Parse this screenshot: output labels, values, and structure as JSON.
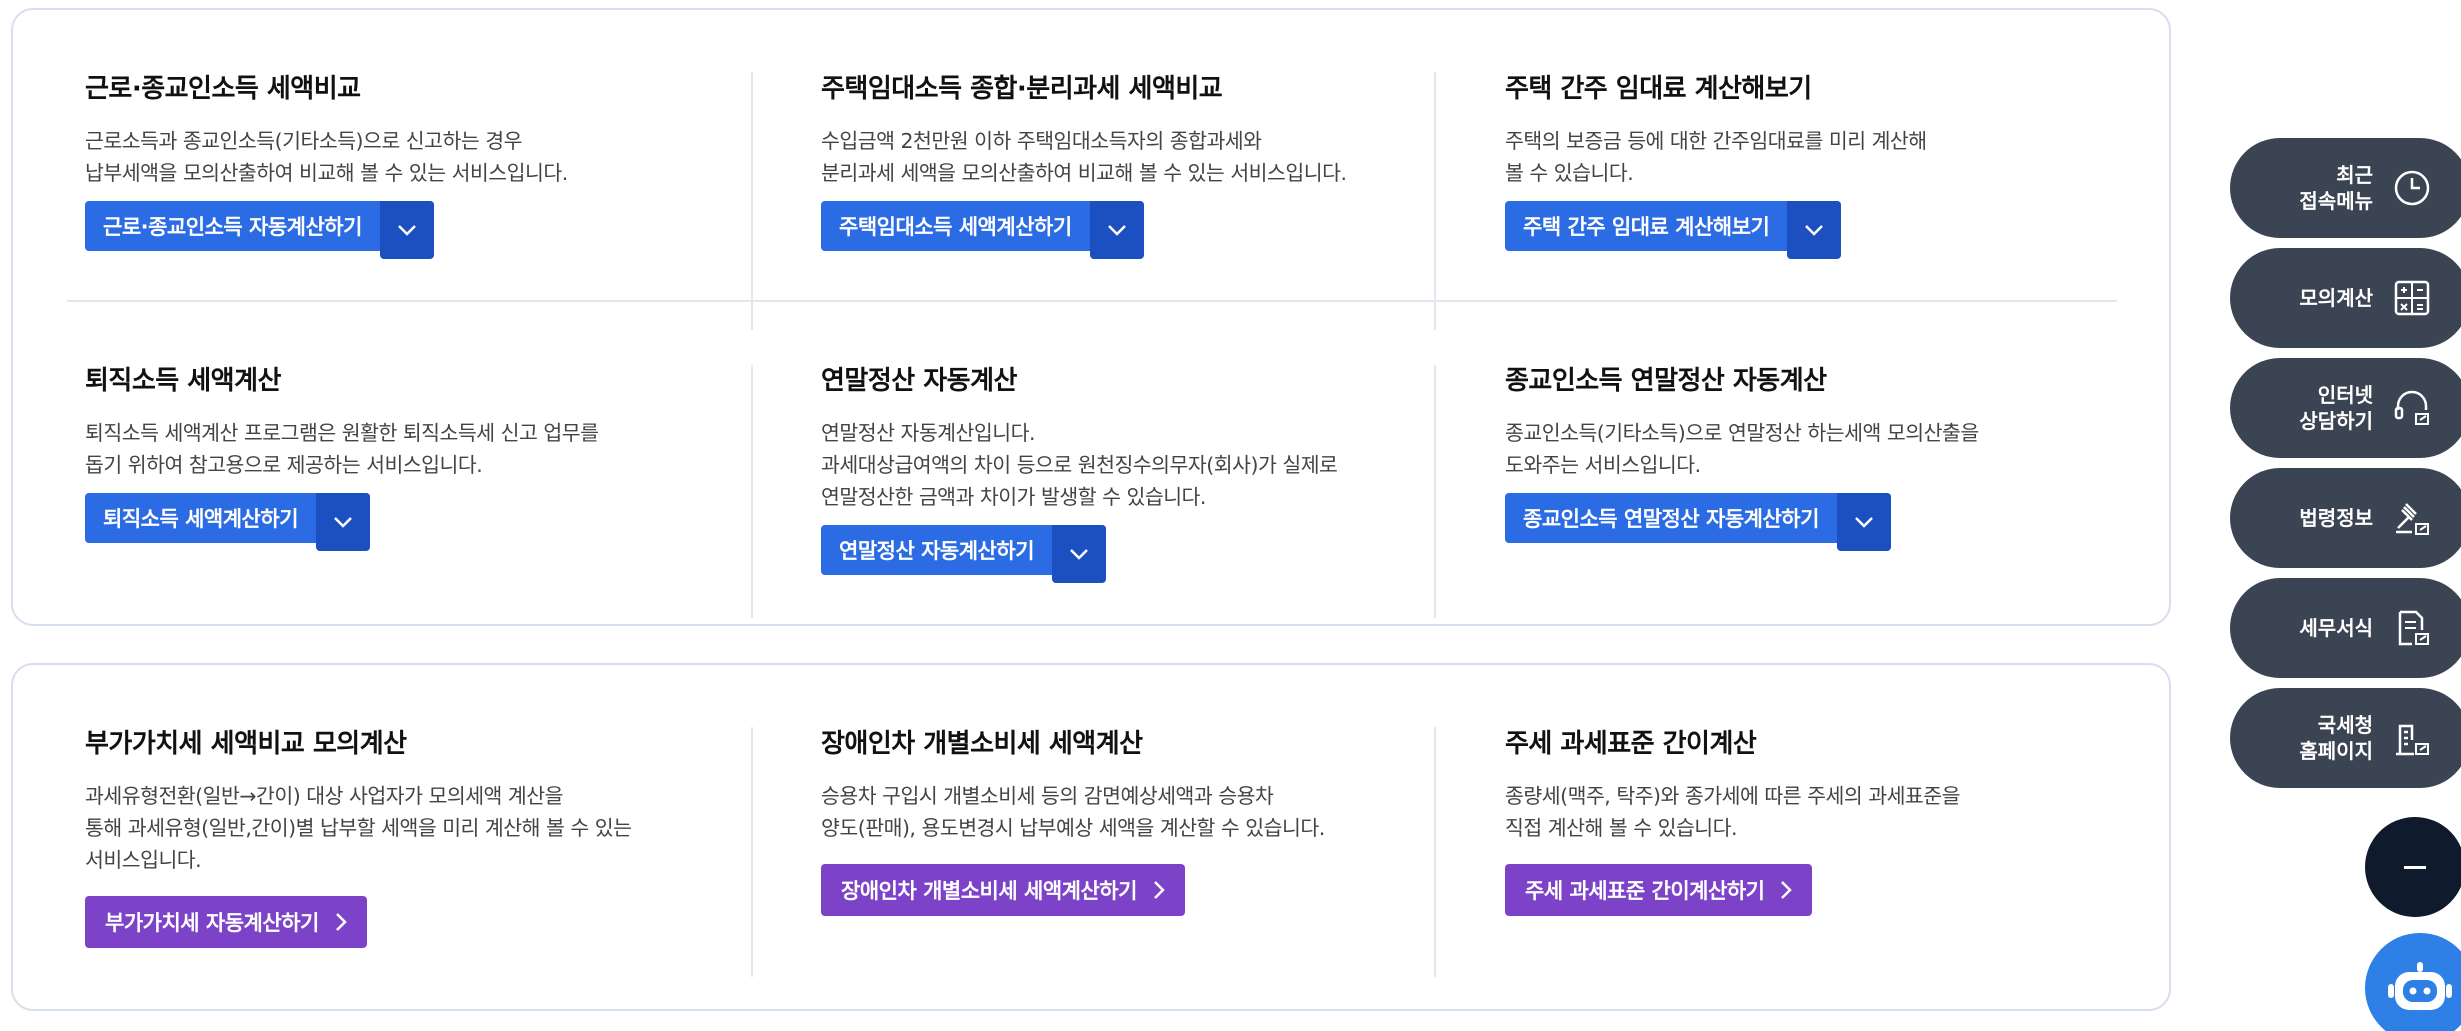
{
  "section1": {
    "cards": [
      {
        "title": "근로·종교인소득 세액비교",
        "desc": "근로소득과 종교인소득(기타소득)으로 신고하는 경우\n납부세액을 모의산출하여 비교해 볼 수 있는 서비스입니다.",
        "button": "근로·종교인소득 자동계산하기"
      },
      {
        "title": "주택임대소득 종합·분리과세 세액비교",
        "desc": "수입금액 2천만원 이하 주택임대소득자의 종합과세와\n분리과세 세액을 모의산출하여 비교해 볼 수 있는 서비스입니다.",
        "button": "주택임대소득 세액계산하기"
      },
      {
        "title": "주택 간주 임대료 계산해보기",
        "desc": "주택의 보증금 등에 대한 간주임대료를 미리 계산해\n볼 수 있습니다.",
        "button": "주택 간주 임대료 계산해보기"
      },
      {
        "title": "퇴직소득 세액계산",
        "desc": "퇴직소득 세액계산 프로그램은 원활한 퇴직소득세 신고 업무를\n돕기 위하여 참고용으로 제공하는 서비스입니다.",
        "button": "퇴직소득 세액계산하기"
      },
      {
        "title": "연말정산 자동계산",
        "desc": "연말정산 자동계산입니다.\n과세대상급여액의 차이 등으로 원천징수의무자(회사)가 실제로\n연말정산한 금액과 차이가 발생할 수 있습니다.",
        "button": "연말정산 자동계산하기"
      },
      {
        "title": "종교인소득 연말정산 자동계산",
        "desc": "종교인소득(기타소득)으로 연말정산 하는세액 모의산출을\n도와주는 서비스입니다.",
        "button": "종교인소득 연말정산 자동계산하기"
      }
    ]
  },
  "section2": {
    "cards": [
      {
        "title": "부가가치세 세액비교 모의계산",
        "desc": "과세유형전환(일반→간이) 대상 사업자가 모의세액 계산을\n통해 과세유형(일반,간이)별 납부할 세액을 미리 계산해 볼 수 있는\n서비스입니다.",
        "button": "부가가치세 자동계산하기"
      },
      {
        "title": "장애인차 개별소비세 세액계산",
        "desc": "승용차 구입시 개별소비세 등의 감면예상세액과 승용차\n양도(판매), 용도변경시 납부예상 세액을 계산할 수 있습니다.",
        "button": "장애인차 개별소비세 세액계산하기"
      },
      {
        "title": "주세 과세표준 간이계산",
        "desc": "종량세(맥주, 탁주)와 종가세에 따른 주세의 과세표준을\n직접 계산해 볼 수 있습니다.",
        "button": "주세 과세표준 간이계산하기"
      }
    ]
  },
  "quick_menu": [
    {
      "label": "최근\n접속메뉴",
      "icon": "clock-icon"
    },
    {
      "label": "모의계산",
      "icon": "calculator-icon"
    },
    {
      "label": "인터넷\n상담하기",
      "icon": "headset-icon"
    },
    {
      "label": "법령정보",
      "icon": "gavel-icon"
    },
    {
      "label": "세무서식",
      "icon": "document-icon"
    },
    {
      "label": "국세청\n홈페이지",
      "icon": "building-icon"
    }
  ],
  "colors": {
    "primary_blue": "#2b6be4",
    "dropdown_blue": "#1c4fc0",
    "purple": "#7c43c8",
    "side_menu": "#3b4452",
    "chatbot": "#2e7fe6"
  }
}
